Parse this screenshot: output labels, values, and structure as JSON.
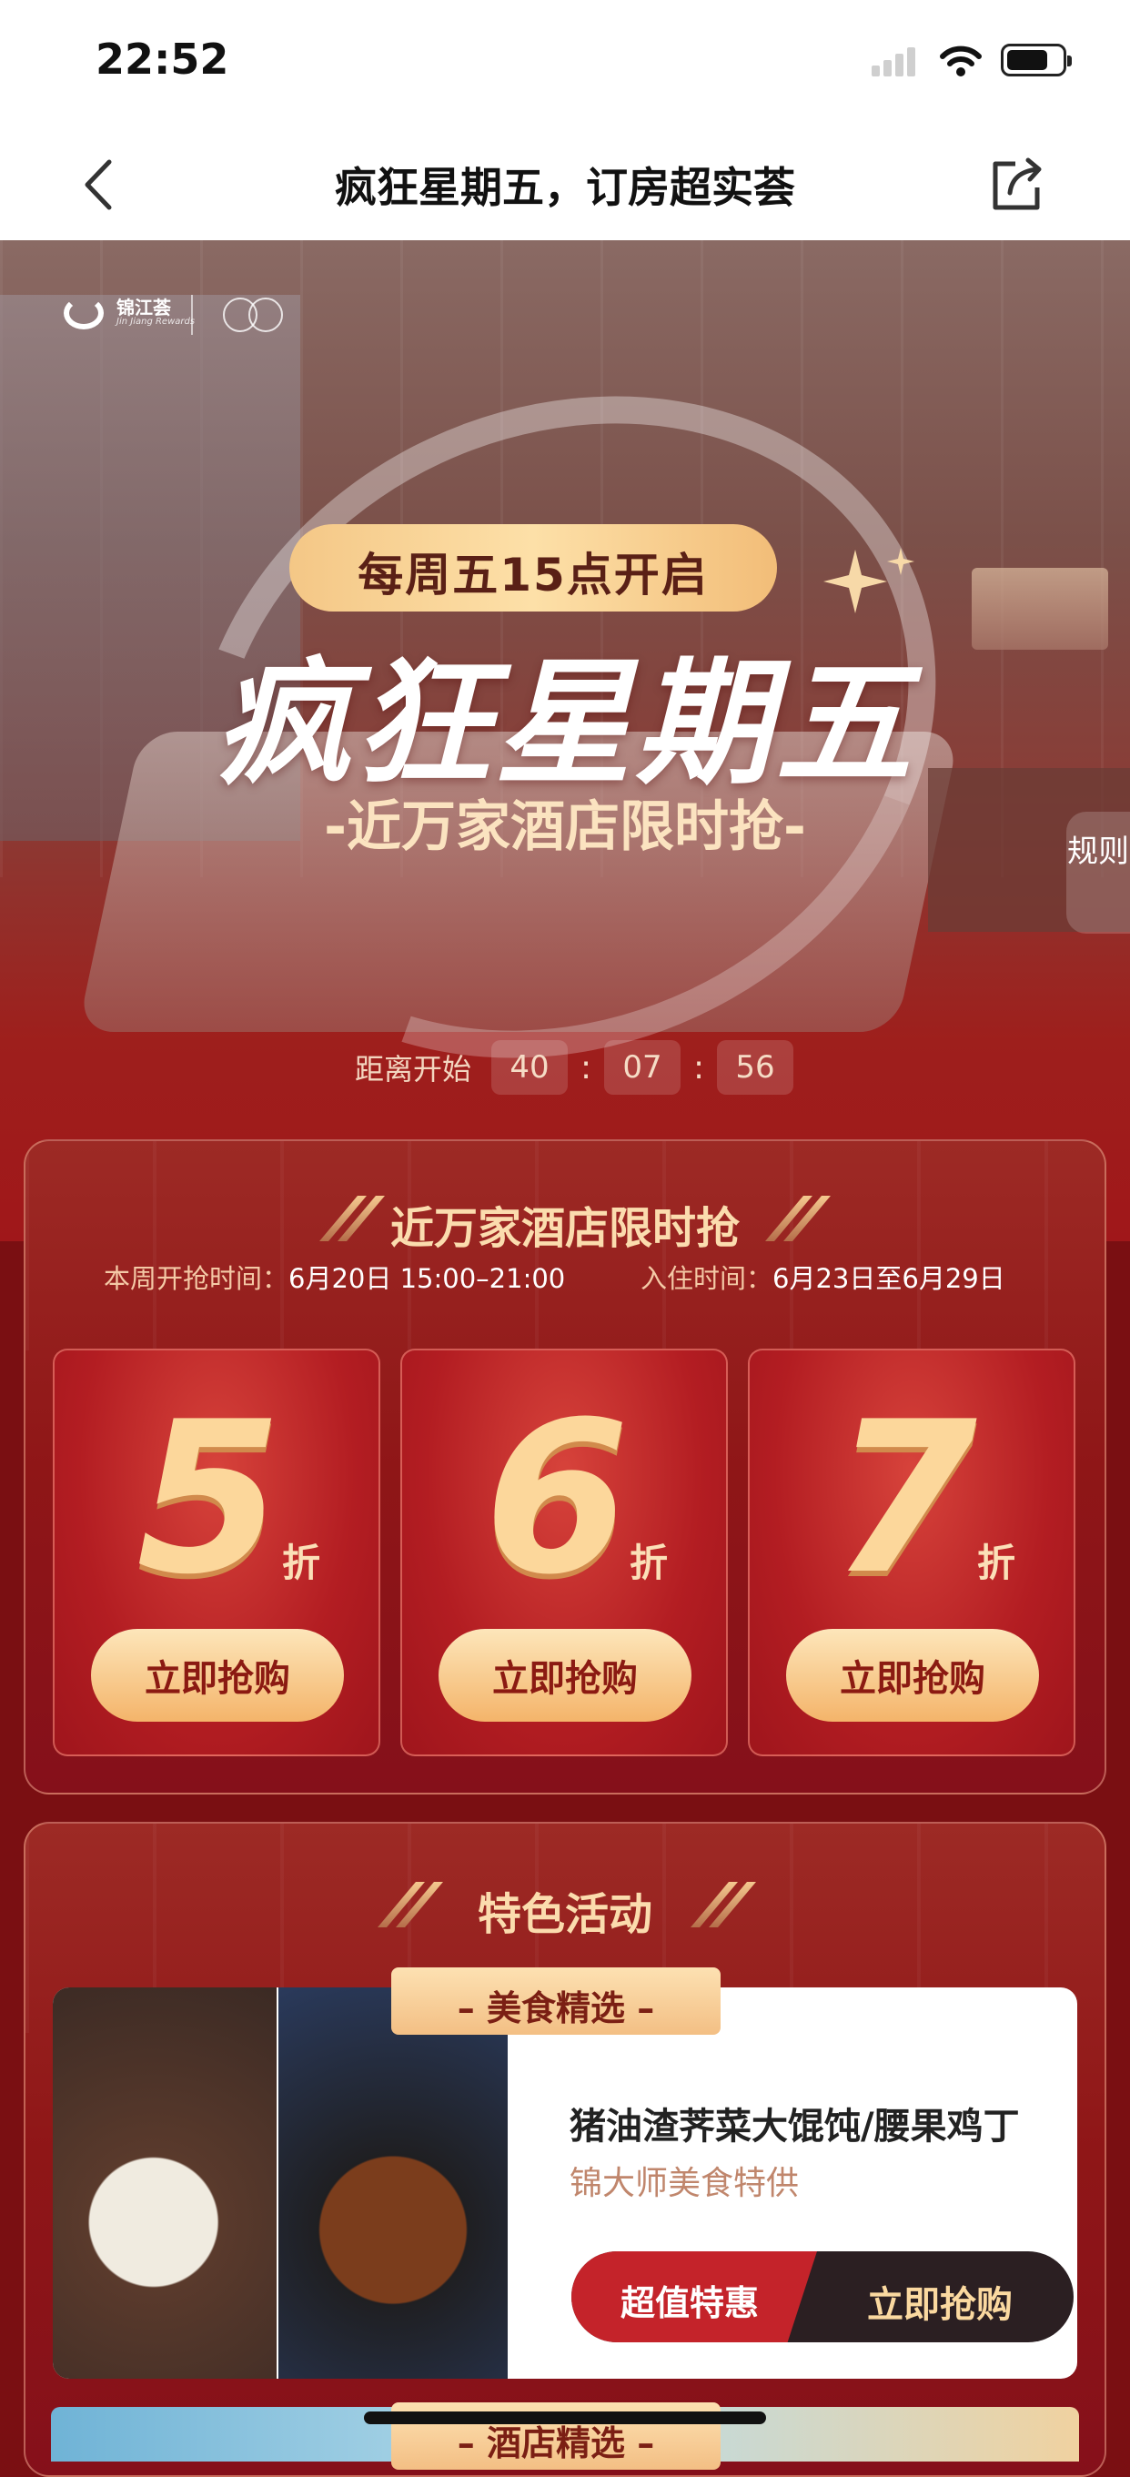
{
  "status_bar": {
    "time": "22:52"
  },
  "nav": {
    "title": "疯狂星期五，订房超实荟"
  },
  "hero": {
    "logo_text": "锦江荟",
    "logo_sub": "Jin Jiang Rewards",
    "pill_text": "每周五15点开启",
    "title": "疯狂星期五",
    "subtitle": "-近万家酒店限时抢-",
    "rules_label": "规则",
    "countdown": {
      "label": "距离开始",
      "h": "40",
      "m": "07",
      "s": "56",
      "sep": ":"
    }
  },
  "flash_sale": {
    "title": "近万家酒店限时抢",
    "sale_time_label": "本周开抢时间",
    "sale_time_value": "6月20日 15:00–21:00",
    "stay_time_label": "入住时间",
    "stay_time_value": "6月23日至6月29日",
    "colon": "：",
    "discounts": [
      {
        "num": "5",
        "unit": "折",
        "button": "立即抢购"
      },
      {
        "num": "6",
        "unit": "折",
        "button": "立即抢购"
      },
      {
        "num": "7",
        "unit": "折",
        "button": "立即抢购"
      }
    ]
  },
  "features": {
    "title": "特色活动",
    "food": {
      "tag": "– 美食精选 –",
      "name": "猪油渣荠菜大馄饨/腰果鸡丁",
      "sub": "锦大师美食特供",
      "deal_label": "超值特惠",
      "buy_label": "立即抢购"
    },
    "hotel_tag": "– 酒店精选 –"
  },
  "colors": {
    "brand_red": "#a0171a",
    "gold": "#fcd79b",
    "cream": "#fde6ba"
  }
}
